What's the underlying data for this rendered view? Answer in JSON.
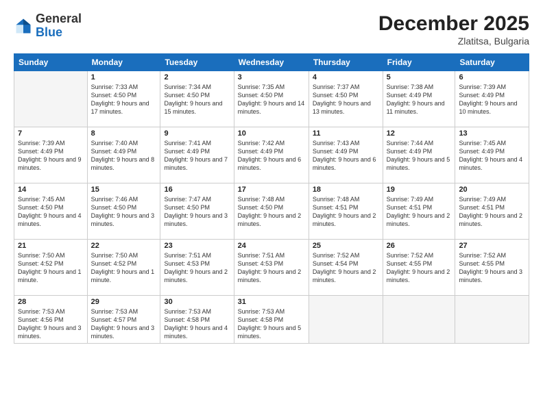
{
  "logo": {
    "general": "General",
    "blue": "Blue"
  },
  "title": "December 2025",
  "subtitle": "Zlatitsa, Bulgaria",
  "days_header": [
    "Sunday",
    "Monday",
    "Tuesday",
    "Wednesday",
    "Thursday",
    "Friday",
    "Saturday"
  ],
  "weeks": [
    [
      {
        "num": "",
        "empty": true
      },
      {
        "num": "1",
        "sunrise": "7:33 AM",
        "sunset": "4:50 PM",
        "daylight": "9 hours and 17 minutes."
      },
      {
        "num": "2",
        "sunrise": "7:34 AM",
        "sunset": "4:50 PM",
        "daylight": "9 hours and 15 minutes."
      },
      {
        "num": "3",
        "sunrise": "7:35 AM",
        "sunset": "4:50 PM",
        "daylight": "9 hours and 14 minutes."
      },
      {
        "num": "4",
        "sunrise": "7:37 AM",
        "sunset": "4:50 PM",
        "daylight": "9 hours and 13 minutes."
      },
      {
        "num": "5",
        "sunrise": "7:38 AM",
        "sunset": "4:49 PM",
        "daylight": "9 hours and 11 minutes."
      },
      {
        "num": "6",
        "sunrise": "7:39 AM",
        "sunset": "4:49 PM",
        "daylight": "9 hours and 10 minutes."
      }
    ],
    [
      {
        "num": "7",
        "sunrise": "7:39 AM",
        "sunset": "4:49 PM",
        "daylight": "9 hours and 9 minutes."
      },
      {
        "num": "8",
        "sunrise": "7:40 AM",
        "sunset": "4:49 PM",
        "daylight": "9 hours and 8 minutes."
      },
      {
        "num": "9",
        "sunrise": "7:41 AM",
        "sunset": "4:49 PM",
        "daylight": "9 hours and 7 minutes."
      },
      {
        "num": "10",
        "sunrise": "7:42 AM",
        "sunset": "4:49 PM",
        "daylight": "9 hours and 6 minutes."
      },
      {
        "num": "11",
        "sunrise": "7:43 AM",
        "sunset": "4:49 PM",
        "daylight": "9 hours and 6 minutes."
      },
      {
        "num": "12",
        "sunrise": "7:44 AM",
        "sunset": "4:49 PM",
        "daylight": "9 hours and 5 minutes."
      },
      {
        "num": "13",
        "sunrise": "7:45 AM",
        "sunset": "4:49 PM",
        "daylight": "9 hours and 4 minutes."
      }
    ],
    [
      {
        "num": "14",
        "sunrise": "7:45 AM",
        "sunset": "4:50 PM",
        "daylight": "9 hours and 4 minutes."
      },
      {
        "num": "15",
        "sunrise": "7:46 AM",
        "sunset": "4:50 PM",
        "daylight": "9 hours and 3 minutes."
      },
      {
        "num": "16",
        "sunrise": "7:47 AM",
        "sunset": "4:50 PM",
        "daylight": "9 hours and 3 minutes."
      },
      {
        "num": "17",
        "sunrise": "7:48 AM",
        "sunset": "4:50 PM",
        "daylight": "9 hours and 2 minutes."
      },
      {
        "num": "18",
        "sunrise": "7:48 AM",
        "sunset": "4:51 PM",
        "daylight": "9 hours and 2 minutes."
      },
      {
        "num": "19",
        "sunrise": "7:49 AM",
        "sunset": "4:51 PM",
        "daylight": "9 hours and 2 minutes."
      },
      {
        "num": "20",
        "sunrise": "7:49 AM",
        "sunset": "4:51 PM",
        "daylight": "9 hours and 2 minutes."
      }
    ],
    [
      {
        "num": "21",
        "sunrise": "7:50 AM",
        "sunset": "4:52 PM",
        "daylight": "9 hours and 1 minute."
      },
      {
        "num": "22",
        "sunrise": "7:50 AM",
        "sunset": "4:52 PM",
        "daylight": "9 hours and 1 minute."
      },
      {
        "num": "23",
        "sunrise": "7:51 AM",
        "sunset": "4:53 PM",
        "daylight": "9 hours and 2 minutes."
      },
      {
        "num": "24",
        "sunrise": "7:51 AM",
        "sunset": "4:53 PM",
        "daylight": "9 hours and 2 minutes."
      },
      {
        "num": "25",
        "sunrise": "7:52 AM",
        "sunset": "4:54 PM",
        "daylight": "9 hours and 2 minutes."
      },
      {
        "num": "26",
        "sunrise": "7:52 AM",
        "sunset": "4:55 PM",
        "daylight": "9 hours and 2 minutes."
      },
      {
        "num": "27",
        "sunrise": "7:52 AM",
        "sunset": "4:55 PM",
        "daylight": "9 hours and 3 minutes."
      }
    ],
    [
      {
        "num": "28",
        "sunrise": "7:53 AM",
        "sunset": "4:56 PM",
        "daylight": "9 hours and 3 minutes."
      },
      {
        "num": "29",
        "sunrise": "7:53 AM",
        "sunset": "4:57 PM",
        "daylight": "9 hours and 3 minutes."
      },
      {
        "num": "30",
        "sunrise": "7:53 AM",
        "sunset": "4:58 PM",
        "daylight": "9 hours and 4 minutes."
      },
      {
        "num": "31",
        "sunrise": "7:53 AM",
        "sunset": "4:58 PM",
        "daylight": "9 hours and 5 minutes."
      },
      {
        "num": "",
        "empty": true
      },
      {
        "num": "",
        "empty": true
      },
      {
        "num": "",
        "empty": true
      }
    ]
  ],
  "labels": {
    "sunrise": "Sunrise:",
    "sunset": "Sunset:",
    "daylight": "Daylight:"
  }
}
